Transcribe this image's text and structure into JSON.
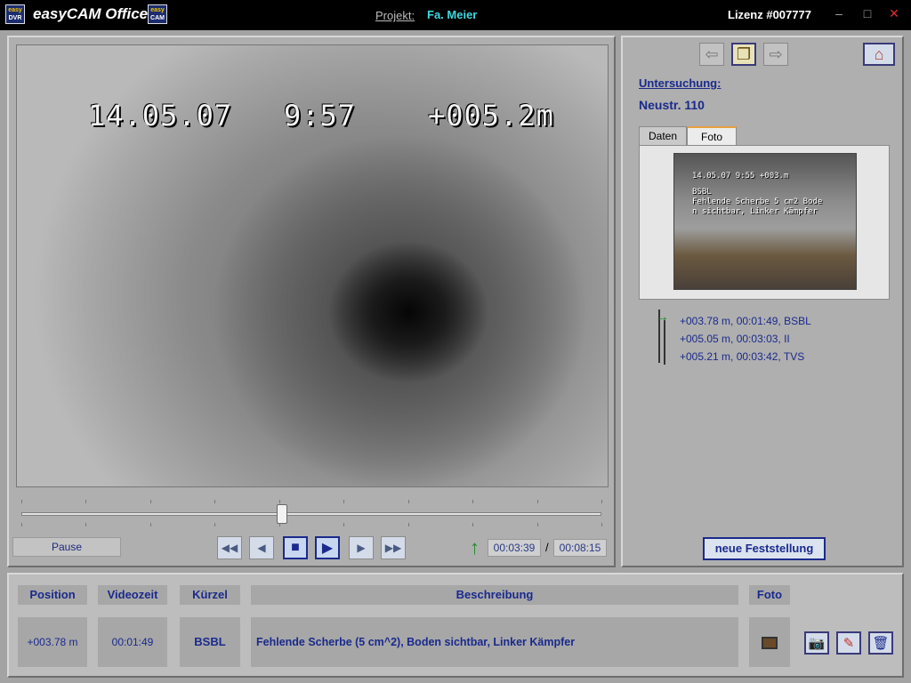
{
  "titlebar": {
    "app_title": "easyCAM Office",
    "logo_dvr": {
      "top": "easy",
      "bottom": "DVR"
    },
    "logo_cam": {
      "top": "easy",
      "bottom": "CAM"
    },
    "project_label": "Projekt:",
    "project_value": "Fa. Meier",
    "license": "Lizenz #007777",
    "minimize": "–",
    "maximize": "□",
    "close": "✕"
  },
  "video": {
    "osd_date": "14.05.07",
    "osd_time": "9:57",
    "osd_distance": "+005.2m",
    "status": "Pause",
    "position_fraction": 0.45,
    "current_time": "00:03:39",
    "total_time": "00:08:15",
    "time_separator": "/"
  },
  "controls": {
    "rewind": "◀◀",
    "step_back": "◀",
    "stop": "■",
    "play": "▶",
    "step_forward": "▶",
    "fast_forward": "▶▶"
  },
  "right": {
    "exam_label": "Untersuchung:",
    "exam_value": "Neustr. 110",
    "tabs": [
      {
        "label": "Daten",
        "active": false
      },
      {
        "label": "Foto",
        "active": true
      }
    ],
    "thumb_lines": [
      "14.05.07   9:55   +003.m",
      "BSBL",
      "Fehlende Scherbe 5 cm2 Bode",
      "n sichtbar, Linker Kämpfer"
    ],
    "findings": [
      "+003.78 m, 00:01:49, BSBL",
      "+005.05 m, 00:03:03, II",
      "+005.21 m, 00:03:42, TVS"
    ],
    "new_finding": "neue Feststellung"
  },
  "table": {
    "headers": [
      "Position",
      "Videozeit",
      "Kürzel",
      "Beschreibung",
      "Foto"
    ],
    "row": {
      "position": "+003.78 m",
      "videotime": "00:01:49",
      "code": "BSBL",
      "description": "Fehlende Scherbe (5 cm^2), Boden sichtbar, Linker Kämpfer"
    }
  },
  "colors": {
    "accent": "#1a2a8c",
    "project": "#3fd9e0",
    "arrow_green": "#1e8a2d"
  }
}
